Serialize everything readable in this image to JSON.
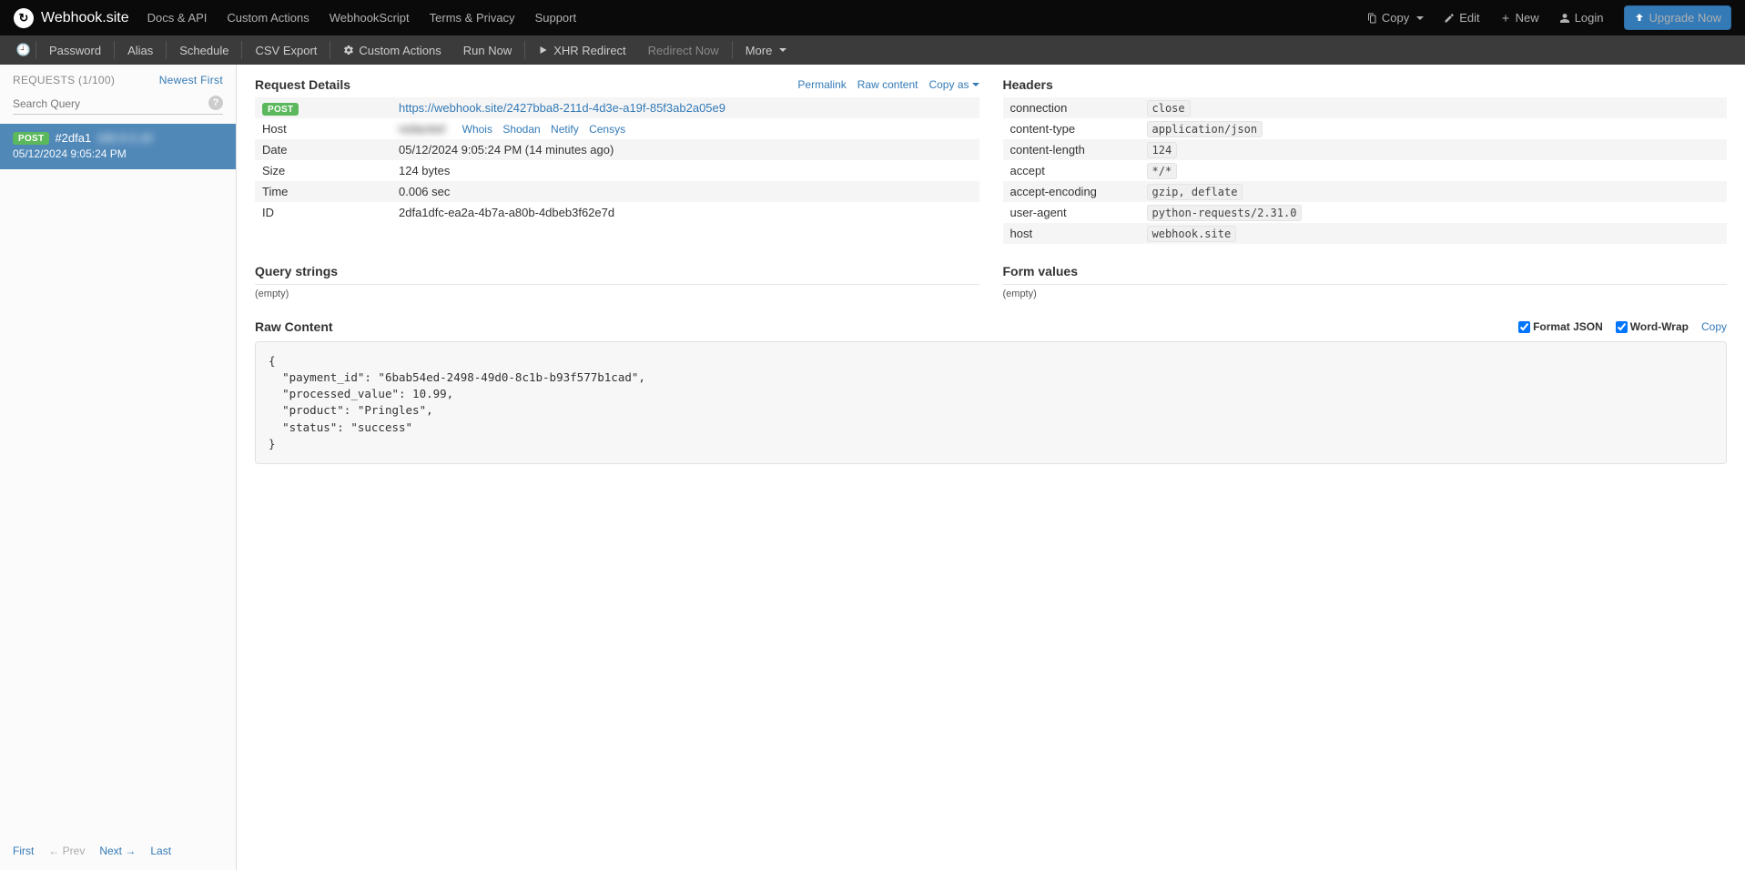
{
  "brand": "Webhook.site",
  "nav": [
    "Docs & API",
    "Custom Actions",
    "WebhookScript",
    "Terms & Privacy",
    "Support"
  ],
  "nav_right": {
    "copy": "Copy",
    "edit": "Edit",
    "new": "New",
    "login": "Login",
    "upgrade": "Upgrade Now"
  },
  "subnav": {
    "items": [
      "Password",
      "Alias",
      "Schedule",
      "CSV Export"
    ],
    "custom_actions": "Custom Actions",
    "run_now": "Run Now",
    "xhr": "XHR Redirect",
    "redirect_now": "Redirect Now",
    "more": "More"
  },
  "sidebar": {
    "heading": "REQUESTS (1/100)",
    "sort": "Newest First",
    "search_placeholder": "Search Query",
    "item": {
      "method": "POST",
      "hash": "#2dfa1",
      "ip": "192.0.2.10",
      "date": "05/12/2024 9:05:24 PM"
    },
    "footer": {
      "first": "First",
      "prev": "← Prev",
      "next": "Next →",
      "last": "Last"
    }
  },
  "details": {
    "title": "Request Details",
    "links": {
      "permalink": "Permalink",
      "raw": "Raw content",
      "copyas": "Copy as"
    },
    "rows": {
      "method": "POST",
      "url": "https://webhook.site/2427bba8-211d-4d3e-a19f-85f3ab2a05e9",
      "host_label": "Host",
      "host_value": "redacted",
      "host_links": [
        "Whois",
        "Shodan",
        "Netify",
        "Censys"
      ],
      "date_label": "Date",
      "date_value": "05/12/2024 9:05:24 PM (14 minutes ago)",
      "size_label": "Size",
      "size_value": "124 bytes",
      "time_label": "Time",
      "time_value": "0.006 sec",
      "id_label": "ID",
      "id_value": "2dfa1dfc-ea2a-4b7a-a80b-4dbeb3f62e7d"
    }
  },
  "headers": {
    "title": "Headers",
    "rows": [
      [
        "connection",
        "close"
      ],
      [
        "content-type",
        "application/json"
      ],
      [
        "content-length",
        "124"
      ],
      [
        "accept",
        "*/*"
      ],
      [
        "accept-encoding",
        "gzip, deflate"
      ],
      [
        "user-agent",
        "python-requests/2.31.0"
      ],
      [
        "host",
        "webhook.site"
      ]
    ]
  },
  "query": {
    "title": "Query strings",
    "empty": "(empty)"
  },
  "form": {
    "title": "Form values",
    "empty": "(empty)"
  },
  "raw": {
    "title": "Raw Content",
    "format": "Format JSON",
    "wrap": "Word-Wrap",
    "copy": "Copy",
    "body": "{\n  \"payment_id\": \"6bab54ed-2498-49d0-8c1b-b93f577b1cad\",\n  \"processed_value\": 10.99,\n  \"product\": \"Pringles\",\n  \"status\": \"success\"\n}"
  }
}
